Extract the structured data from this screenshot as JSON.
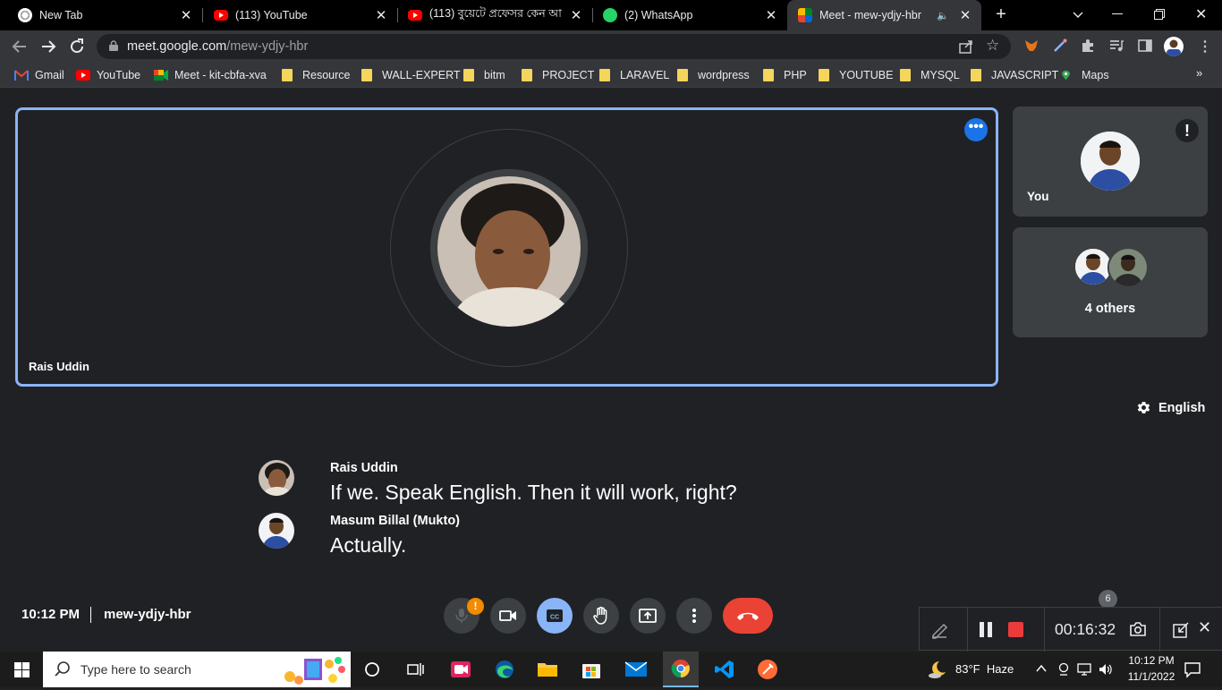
{
  "browser": {
    "tabs": [
      {
        "title": "New Tab",
        "icon": "chrome-icon"
      },
      {
        "title": "(113) YouTube",
        "icon": "youtube-icon"
      },
      {
        "title": "(113) বুয়েটে প্রফেসর কেন আ",
        "icon": "youtube-icon"
      },
      {
        "title": "(2) WhatsApp",
        "icon": "whatsapp-icon"
      },
      {
        "title": "Meet - mew-ydjy-hbr",
        "icon": "meet-icon",
        "active": true
      }
    ],
    "url_domain": "meet.google.com",
    "url_path": "/mew-ydjy-hbr",
    "bookmarks": [
      "Gmail",
      "YouTube",
      "Meet - kit-cbfa-xva",
      "Resource",
      "WALL-EXPERT",
      "bitm",
      "PROJECT",
      "LARAVEL",
      "wordpress",
      "PHP",
      "YOUTUBE",
      "MYSQL",
      "JAVASCRIPT",
      "Maps"
    ]
  },
  "meet": {
    "main_tile_name": "Rais Uddin",
    "self_tile_name": "You",
    "others_label": "4 others",
    "caption_language": "English",
    "captions": [
      {
        "speaker": "Rais Uddin",
        "text": "If we. Speak English. Then it will work, right?"
      },
      {
        "speaker": "Masum Billal (Mukto)",
        "text": "Actually."
      }
    ],
    "time": "10:12 PM",
    "meeting_code": "mew-ydjy-hbr",
    "mic_alert": "!"
  },
  "recorder": {
    "elapsed": "00:16:32",
    "badge_count": "6"
  },
  "taskbar": {
    "search_placeholder": "Type here to search",
    "weather_temp": "83°F",
    "weather_desc": "Haze",
    "clock_time": "10:12 PM",
    "clock_date": "11/1/2022"
  },
  "colors": {
    "meet_bg": "#202124",
    "tile_border": "#8ab4f8",
    "end_call": "#ea4335",
    "cc_active": "#8ab4f8"
  }
}
